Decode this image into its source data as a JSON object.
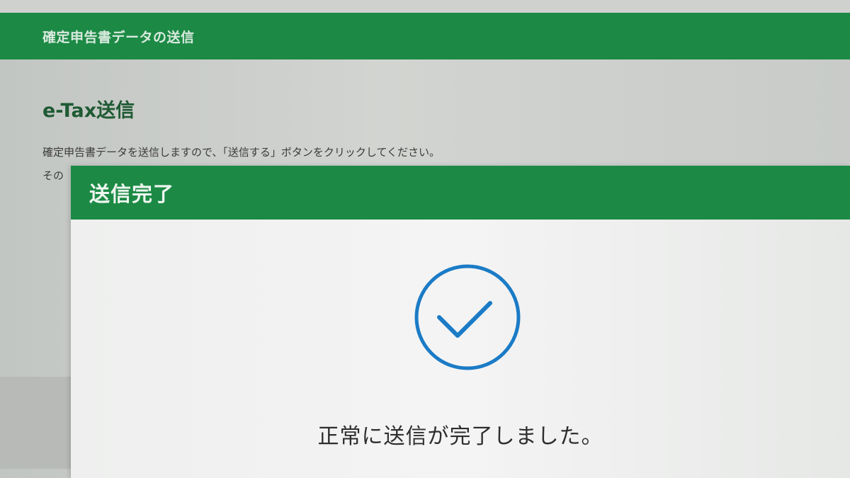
{
  "page": {
    "header_title": "確定申告書データの送信",
    "section_title": "e-Tax送信",
    "description": "確定申告書データを送信しますので、「送信する」ボタンをクリックしてください。",
    "description_2": "その"
  },
  "modal": {
    "title": "送信完了",
    "message": "正常に送信が完了しました。",
    "icon": "checkmark-circle-icon"
  },
  "colors": {
    "header_green": "#1c8a45",
    "check_blue": "#1b7bc6"
  }
}
